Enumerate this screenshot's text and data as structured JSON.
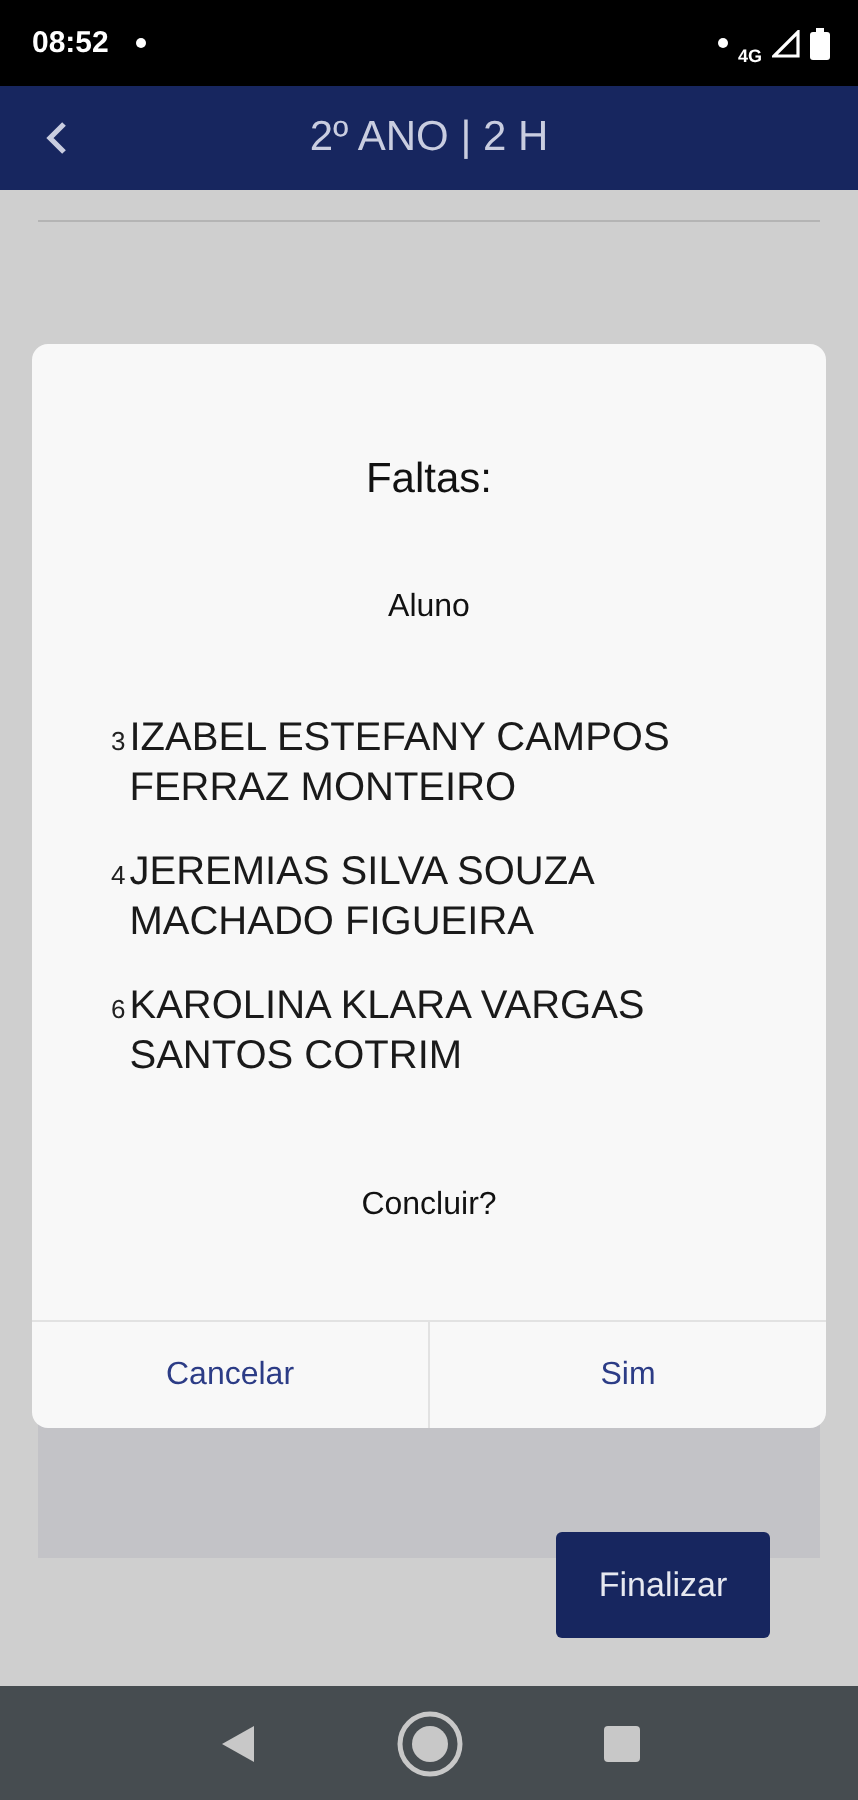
{
  "status_bar": {
    "time": "08:52",
    "network": "4G"
  },
  "header": {
    "title": "2º ANO | 2 H"
  },
  "dialog": {
    "title": "Faltas:",
    "subtitle": "Aluno",
    "students": [
      {
        "number": "3",
        "name": "IZABEL ESTEFANY CAMPOS FERRAZ MONTEIRO"
      },
      {
        "number": "4",
        "name": "JEREMIAS SILVA SOUZA MACHADO FIGUEIRA"
      },
      {
        "number": "6",
        "name": "KAROLINA KLARA VARGAS SANTOS COTRIM"
      }
    ],
    "question": "Concluir?",
    "buttons": [
      "Cancelar",
      "Sim"
    ]
  },
  "finish_button": "Finalizar"
}
